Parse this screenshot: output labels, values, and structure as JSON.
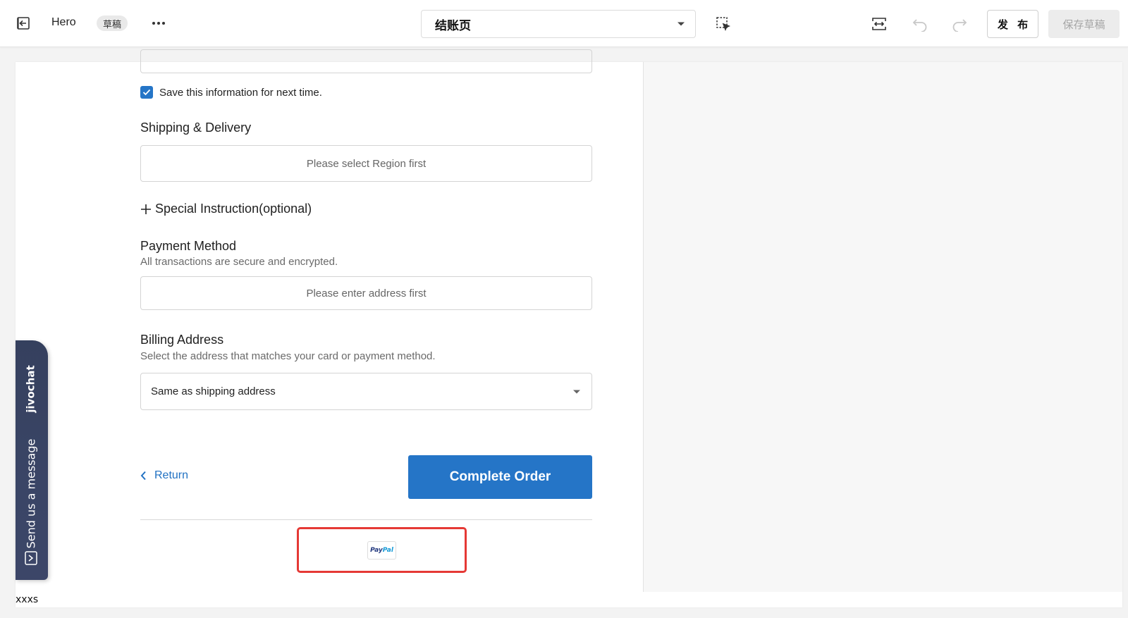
{
  "toolbar": {
    "app_name": "Hero",
    "draft_badge": "草稿",
    "page_select_value": "结账页",
    "publish_label": "发 布",
    "save_draft_label": "保存草稿"
  },
  "form": {
    "save_info_label": "Save this information for next time.",
    "save_info_checked": true,
    "shipping_title": "Shipping & Delivery",
    "shipping_placeholder": "Please select Region first",
    "special_instruction_label": "Special Instruction(optional)",
    "payment_title": "Payment Method",
    "payment_subtitle": "All transactions are secure and encrypted.",
    "payment_placeholder": "Please enter address first",
    "billing_title": "Billing Address",
    "billing_subtitle": "Select the address that matches your card or payment method.",
    "billing_selected": "Same as shipping address",
    "return_label": "Return",
    "complete_order_label": "Complete Order",
    "paypal_part1": "Pay",
    "paypal_part2": "Pal"
  },
  "chat": {
    "brand": "jivochat",
    "message": "Send us a message"
  },
  "footer_label": "xxxs",
  "colors": {
    "accent": "#2575c7",
    "highlight_border": "#e53935",
    "chat_bg": "#3a4566"
  },
  "icons": [
    "exit-icon",
    "more-icon",
    "chevron-down-icon",
    "select-element-icon",
    "viewport-icon",
    "undo-icon",
    "redo-icon",
    "check-icon",
    "plus-icon",
    "chevron-left-icon",
    "chat-send-icon"
  ]
}
